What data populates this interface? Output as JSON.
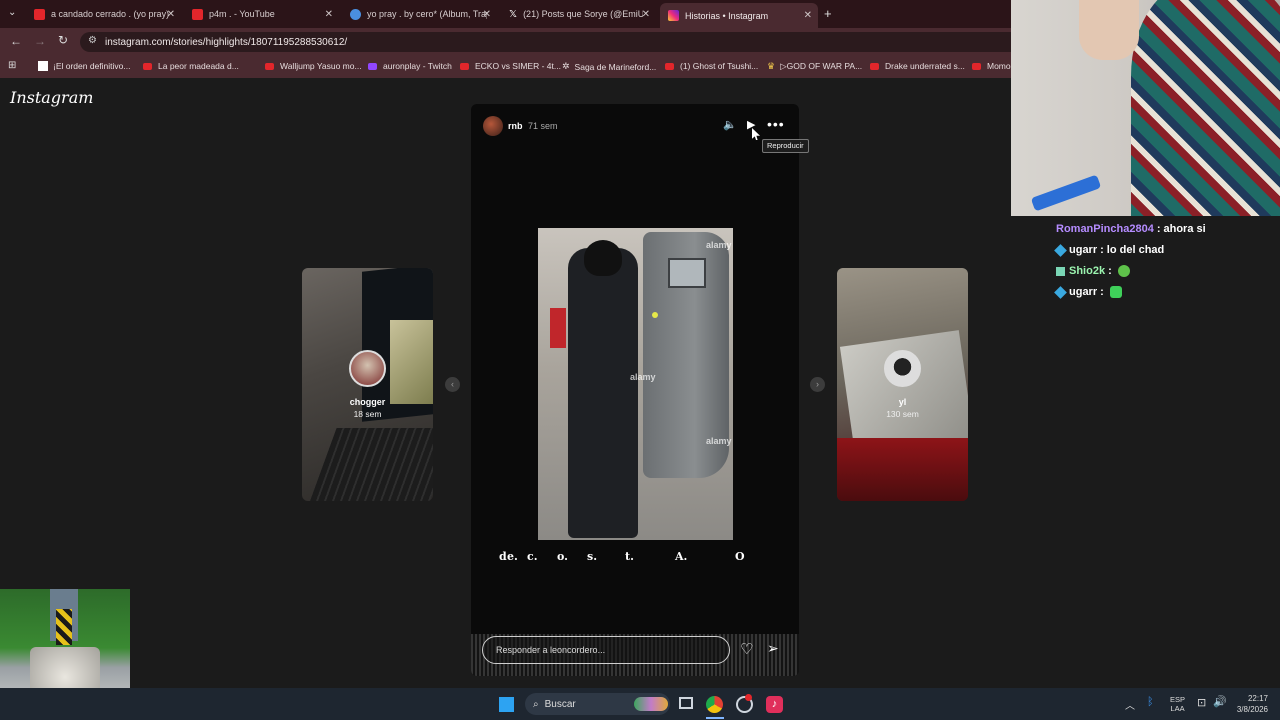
{
  "browser": {
    "tabs": [
      {
        "title": "a candado cerrado . (yo pray) -",
        "icon": "youtube-icon",
        "color": "#e3262b"
      },
      {
        "title": "p4m . - YouTube",
        "icon": "youtube-icon",
        "color": "#e3262b"
      },
      {
        "title": "yo pray . by cero* (Album, Trap",
        "icon": "globe-icon",
        "color": "#4a8fe0"
      },
      {
        "title": "(21) Posts que Sorye (@EmiUv",
        "icon": "x-icon",
        "color": "#ffffff"
      },
      {
        "title": "Historias • Instagram",
        "icon": "instagram-icon",
        "color": "#d62976"
      }
    ],
    "url": "instagram.com/stories/highlights/18071195288530612/",
    "bookmarks": [
      "¡El orden definitivo...",
      "La peor madeada d...",
      "Walljump Yasuo mo...",
      "auronplay - Twitch",
      "ECKO vs SIMER - 4t...",
      "Saga de Marineford...",
      "(1) Ghost of Tsushi...",
      "▷GOD OF WAR PA...",
      "Drake underrated s...",
      "Momo"
    ]
  },
  "instagram": {
    "logo": "Instagram",
    "story": {
      "username": "rnb",
      "time": "71 sem",
      "tooltip": "Reproducir",
      "caption": [
        "d",
        "e.",
        "c.",
        "o.",
        "s.",
        "t.",
        "A.",
        "O"
      ],
      "reply_placeholder": "Responder a leoncordero...",
      "watermark": "alamy"
    },
    "prev_story": {
      "username": "chogger",
      "time": "18 sem"
    },
    "next_story": {
      "username": "yl",
      "time": "130 sem"
    }
  },
  "chat": [
    {
      "user": "RomanPincha2804",
      "message": "ahora si",
      "color": "#b58cff",
      "badge": false
    },
    {
      "user": "ugarr",
      "message": "lo del chad",
      "color": "#ffffff",
      "badge": true
    },
    {
      "user": "Shio2k",
      "message": "",
      "color": "#9cf5b0",
      "badge": true,
      "emote": true
    },
    {
      "user": "ugarr",
      "message": "",
      "color": "#ffffff",
      "badge": true,
      "emote": true
    }
  ],
  "taskbar": {
    "search": "Buscar",
    "lang_top": "ESP",
    "lang_bottom": "LAA",
    "time": "22:17",
    "date": "3/8/2026"
  }
}
